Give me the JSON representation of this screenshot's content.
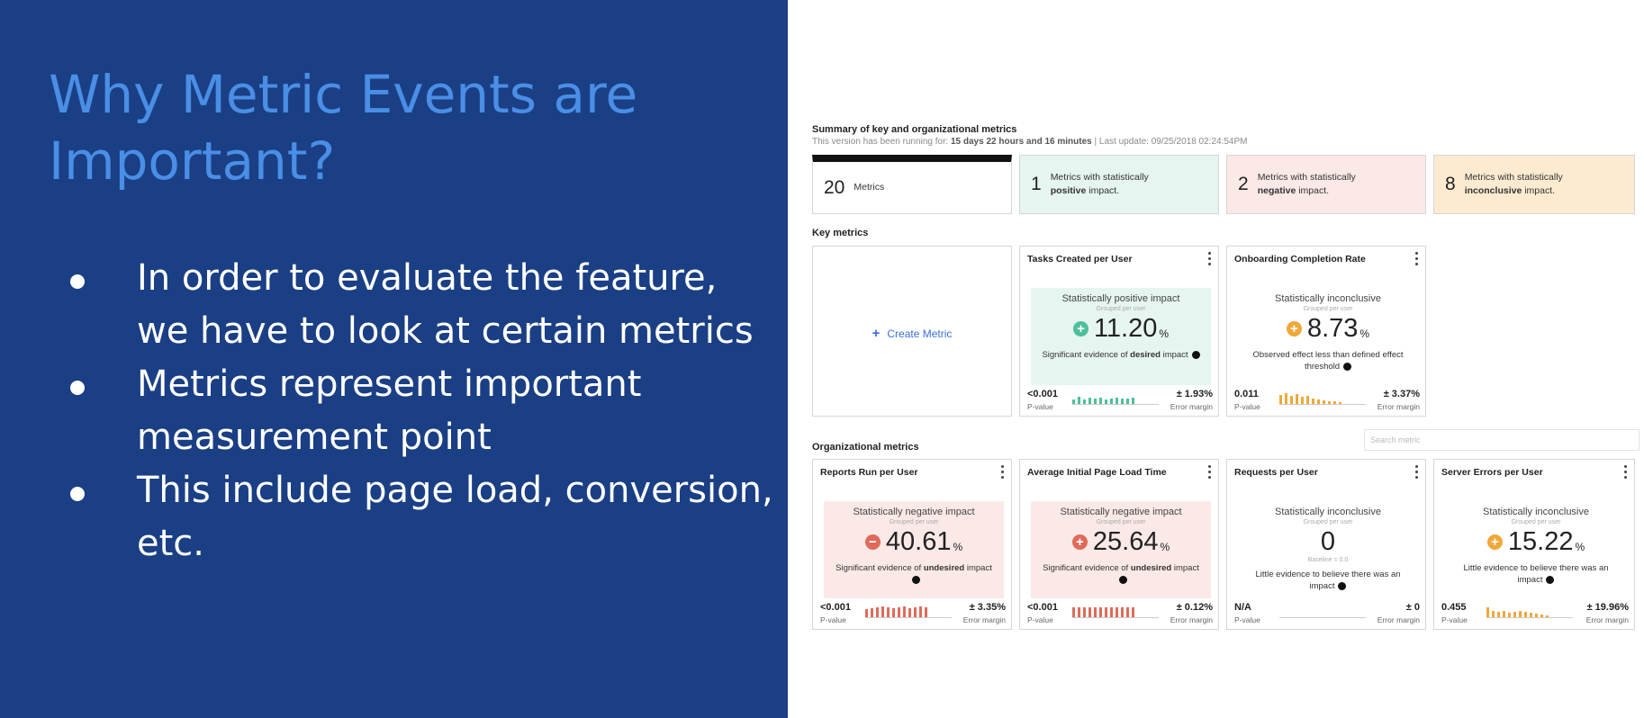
{
  "slide": {
    "title": "Why Metric Events are Important?",
    "bullets": [
      "In order to evaluate the feature, we have to look at certain metrics",
      "Metrics represent important measurement point",
      "This include page load, conversion, etc."
    ],
    "background_color": "#1a3f84",
    "title_color": "#4a8ee6"
  },
  "summary": {
    "title": "Summary of key and organizational metrics",
    "running_prefix": "This version has been running for:",
    "running_duration": "15 days 22 hours and 16 minutes",
    "separator": "|",
    "last_update_prefix": "Last update:",
    "last_update": "09/25/2018 02:24:54PM",
    "cards": [
      {
        "count": "20",
        "line1": "Metrics",
        "line2_prefix": "",
        "line2_bold": "",
        "line2_suffix": ""
      },
      {
        "count": "1",
        "line1": "Metrics with statistically",
        "line2_prefix": "",
        "line2_bold": "positive",
        "line2_suffix": " impact."
      },
      {
        "count": "2",
        "line1": "Metrics with statistically",
        "line2_prefix": "",
        "line2_bold": "negative",
        "line2_suffix": " impact."
      },
      {
        "count": "8",
        "line1": "Metrics with statistically",
        "line2_prefix": "",
        "line2_bold": "inconclusive",
        "line2_suffix": " impact."
      }
    ]
  },
  "key_metrics": {
    "label": "Key metrics",
    "create_label": "Create Metric",
    "cards": [
      {
        "title": "Tasks Created per User",
        "status": "Statistically positive impact",
        "grouped": "Grouped per user",
        "value": "11.20",
        "unit": "%",
        "badge": "+",
        "evidence_prefix": "Significant evidence of ",
        "evidence_bold": "desired",
        "evidence_suffix": " impact",
        "p_value": "<0.001",
        "p_label": "P-value",
        "error": "± 1.93%",
        "error_label": "Error margin"
      },
      {
        "title": "Onboarding Completion Rate",
        "status": "Statistically inconclusive",
        "grouped": "Grouped per user",
        "value": "8.73",
        "unit": "%",
        "badge": "+",
        "evidence_prefix": "Observed effect less than defined effect threshold",
        "evidence_bold": "",
        "evidence_suffix": "",
        "p_value": "0.011",
        "p_label": "P-value",
        "error": "± 3.37%",
        "error_label": "Error margin"
      }
    ]
  },
  "org_metrics": {
    "label": "Organizational metrics",
    "search_placeholder": "Search metric",
    "cards": [
      {
        "title": "Reports Run per User",
        "status": "Statistically negative impact",
        "grouped": "Grouped per user",
        "value": "40.61",
        "unit": "%",
        "badge": "−",
        "evidence_prefix": "Significant evidence of ",
        "evidence_bold": "undesired",
        "evidence_suffix": " impact",
        "p_value": "<0.001",
        "p_label": "P-value",
        "error": "± 3.35%",
        "error_label": "Error margin"
      },
      {
        "title": "Average Initial Page Load Time",
        "status": "Statistically negative impact",
        "grouped": "Grouped per user",
        "value": "25.64",
        "unit": "%",
        "badge": "+",
        "evidence_prefix": "Significant evidence of ",
        "evidence_bold": "undesired",
        "evidence_suffix": " impact",
        "p_value": "<0.001",
        "p_label": "P-value",
        "error": "± 0.12%",
        "error_label": "Error margin"
      },
      {
        "title": "Requests per User",
        "status": "Statistically inconclusive",
        "grouped": "Grouped per user",
        "value": "0",
        "unit": "",
        "baseline": "Baseline = 0.0",
        "evidence_prefix": "Little evidence to believe there was an impact",
        "evidence_bold": "",
        "evidence_suffix": "",
        "p_value": "N/A",
        "p_label": "P-value",
        "error": "± 0",
        "error_label": "Error margin"
      },
      {
        "title": "Server Errors per User",
        "status": "Statistically inconclusive",
        "grouped": "Grouped per user",
        "value": "15.22",
        "unit": "%",
        "badge": "+",
        "evidence_prefix": "Little evidence to believe there was an impact",
        "evidence_bold": "",
        "evidence_suffix": "",
        "p_value": "0.455",
        "p_label": "P-value",
        "error": "± 19.96%",
        "error_label": "Error margin"
      }
    ]
  },
  "colors": {
    "positive": "#4cbf9c",
    "negative": "#e06a5a",
    "inconclusive": "#f0a83a",
    "link": "#3b6ed8"
  }
}
